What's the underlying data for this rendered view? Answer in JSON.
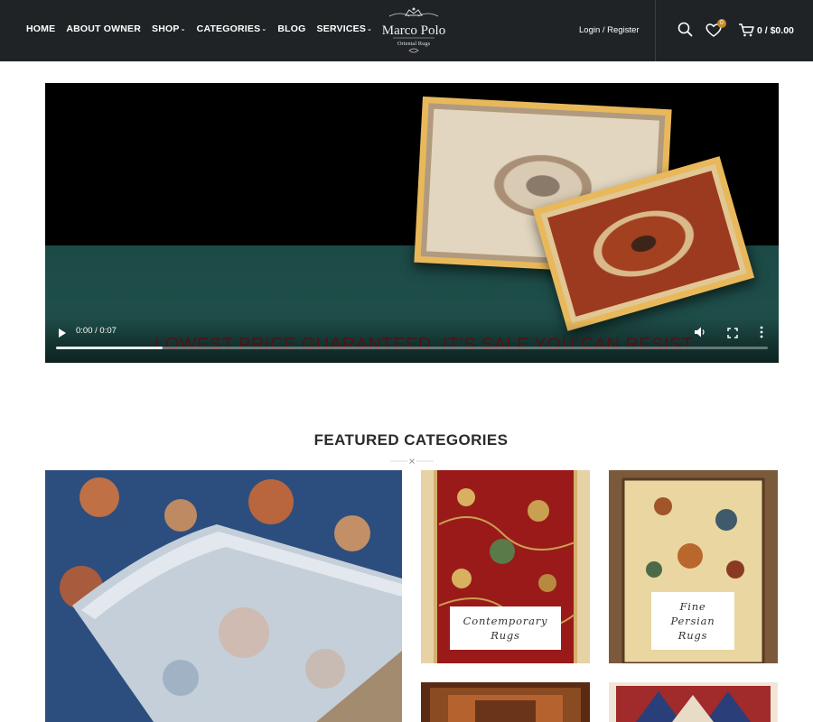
{
  "header": {
    "nav": [
      {
        "label": "HOME",
        "has_dropdown": false
      },
      {
        "label": "ABOUT OWNER",
        "has_dropdown": false
      },
      {
        "label": "SHOP",
        "has_dropdown": true
      },
      {
        "label": "CATEGORIES",
        "has_dropdown": true
      },
      {
        "label": "BLOG",
        "has_dropdown": false
      },
      {
        "label": "SERVICES",
        "has_dropdown": true
      }
    ],
    "logo": {
      "name": "Marco Polo",
      "tagline": "Oriental Rugs"
    },
    "login_label": "Login / Register",
    "wishlist_count": "0",
    "cart_text": "0 / $0.00",
    "icons": {
      "search": "search-icon",
      "wishlist": "heart-icon",
      "cart": "cart-icon",
      "dropdown": "chevron-down-icon"
    }
  },
  "video": {
    "time": "0:00 / 0:07",
    "progress": 0.15,
    "overlay_text": "LOWEST PRICE GUARANTEED. IT'S SALE YOU CAN RESIST",
    "icons": {
      "play": "play-icon",
      "volume": "volume-icon",
      "fullscreen": "fullscreen-icon",
      "more": "more-vertical-icon"
    }
  },
  "featured": {
    "title": "FEATURED CATEGORIES",
    "categories": [
      {
        "label": ""
      },
      {
        "label": "Contemporary Rugs"
      },
      {
        "label": "Fine Persian Rugs"
      }
    ]
  },
  "colors": {
    "header_bg": "#1f2326",
    "badge": "#c98a21",
    "overlay_text": "#5a0d10"
  }
}
